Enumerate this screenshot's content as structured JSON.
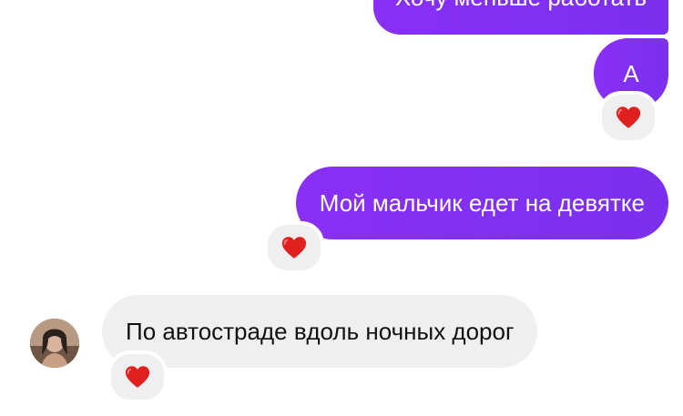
{
  "messages": [
    {
      "direction": "outgoing",
      "text": "Хочу меньше работать"
    },
    {
      "direction": "outgoing",
      "text": "А",
      "reaction": "heart"
    },
    {
      "direction": "outgoing",
      "text": "Мой мальчик едет на девятке",
      "reaction": "heart"
    },
    {
      "direction": "incoming",
      "text": "По автостраде вдоль ночных дорог",
      "reaction": "heart",
      "avatar": "contact-avatar"
    }
  ],
  "colors": {
    "outgoing_bubble_start": "#8a2ff6",
    "outgoing_bubble_end": "#7a30ec",
    "incoming_bubble": "#efefef",
    "reaction_bg": "#efefef",
    "heart": "#e0201f"
  },
  "icons": {
    "reaction": "heart-icon"
  }
}
